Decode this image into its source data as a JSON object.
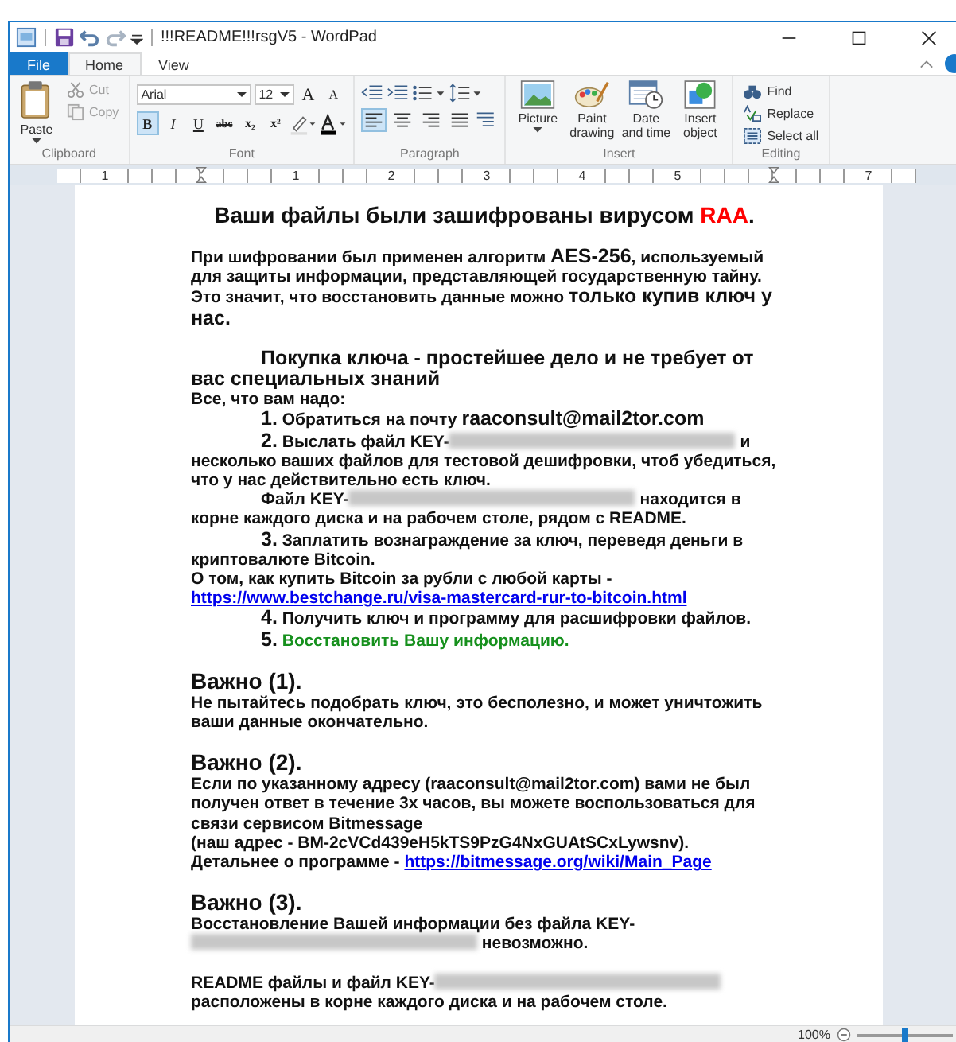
{
  "window": {
    "title": "!!!README!!!rsgV5 - WordPad"
  },
  "tabs": [
    {
      "label": "File",
      "kind": "file",
      "selected": false
    },
    {
      "label": "Home",
      "kind": "tab",
      "selected": true
    },
    {
      "label": "View",
      "kind": "tab",
      "selected": false
    }
  ],
  "ribbon": {
    "clipboard": {
      "label": "Clipboard",
      "paste": "Paste",
      "small": [
        {
          "label": "Cut",
          "kind": "cut",
          "disabled": true
        },
        {
          "label": "Copy",
          "kind": "copy",
          "disabled": true
        }
      ]
    },
    "font": {
      "label": "Font",
      "font_name": "Arial",
      "font_size": "12",
      "size_buttons": [
        {
          "label": "A",
          "kind": "grow"
        },
        {
          "label": "A",
          "kind": "shrink"
        }
      ],
      "format_buttons": [
        {
          "label": "B",
          "kind": "bold",
          "selected": true
        },
        {
          "label": "I",
          "kind": "italic",
          "selected": false
        },
        {
          "label": "U",
          "kind": "underline",
          "selected": false
        },
        {
          "label": "abc",
          "kind": "strike",
          "selected": false
        },
        {
          "label": "x₂",
          "kind": "sub",
          "selected": false
        },
        {
          "label": "x²",
          "kind": "sup",
          "selected": false
        }
      ]
    },
    "paragraph": {
      "label": "Paragraph",
      "align_buttons": [
        {
          "kind": "left",
          "selected": true
        },
        {
          "kind": "center",
          "selected": false
        },
        {
          "kind": "right",
          "selected": false
        },
        {
          "kind": "justify",
          "selected": false
        }
      ]
    },
    "insert": {
      "label": "Insert",
      "buttons": [
        {
          "label": "Picture",
          "kind": "picture"
        },
        {
          "label": "Paint drawing",
          "kind": "paint"
        },
        {
          "label": "Date and time",
          "kind": "datetime"
        },
        {
          "label": "Insert object",
          "kind": "object"
        }
      ]
    },
    "editing": {
      "label": "Editing",
      "buttons": [
        {
          "label": "Find",
          "kind": "find"
        },
        {
          "label": "Replace",
          "kind": "replace"
        },
        {
          "label": "Select all",
          "kind": "selectall"
        }
      ]
    }
  },
  "ruler": {
    "marks": [
      {
        "kind": "number",
        "label": "1"
      },
      {
        "kind": "marker"
      },
      {
        "kind": "number",
        "label": "1"
      },
      {
        "kind": "number",
        "label": "2"
      },
      {
        "kind": "number",
        "label": "3"
      },
      {
        "kind": "number",
        "label": "4"
      },
      {
        "kind": "number",
        "label": "5"
      },
      {
        "kind": "marker"
      },
      {
        "kind": "number",
        "label": "7"
      }
    ]
  },
  "document": [
    {
      "kind": "title",
      "segments": [
        {
          "text": "Ваши файлы были зашифрованы вирусом "
        },
        {
          "text": "RAA",
          "kind": "red"
        },
        {
          "text": "."
        }
      ]
    },
    {
      "kind": "blank"
    },
    {
      "kind": "para",
      "segments": [
        {
          "text": "При шифровании был применен алгоритм "
        },
        {
          "text": "AES-256",
          "kind": "large"
        },
        {
          "text": ", используемый для защиты информации, представляющей государственную тайну."
        }
      ]
    },
    {
      "kind": "para",
      "segments": [
        {
          "text": "Это значит, что восстановить данные можно "
        },
        {
          "text": "только купив ключ у нас.",
          "kind": "large"
        }
      ]
    },
    {
      "kind": "blank"
    },
    {
      "kind": "indented",
      "segments": [
        {
          "text": "Покупка ключа - простейшее дело и не требует от вас специальных знаний",
          "kind": "large"
        }
      ]
    },
    {
      "kind": "para",
      "segments": [
        {
          "text": "Все, что вам надо:"
        }
      ]
    },
    {
      "kind": "indented",
      "segments": [
        {
          "text": "1.",
          "kind": "large"
        },
        {
          "text": " Обратиться на почту "
        },
        {
          "text": "raaconsult@mail2tor.com",
          "kind": "large"
        }
      ]
    },
    {
      "kind": "indented",
      "segments": [
        {
          "text": "2.",
          "kind": "large"
        },
        {
          "text": " Выслать файл KEY-"
        },
        {
          "kind": "redaction"
        },
        {
          "text": " и несколько ваших файлов для тестовой дешифровки, чтоб убедиться, что у нас действительно есть ключ."
        }
      ]
    },
    {
      "kind": "indented",
      "segments": [
        {
          "text": "Файл KEY-"
        },
        {
          "kind": "redaction"
        },
        {
          "text": " находится в корне каждого диска и на рабочем столе, рядом с README."
        }
      ]
    },
    {
      "kind": "indented",
      "segments": [
        {
          "text": "3.",
          "kind": "large"
        },
        {
          "text": " Заплатить вознаграждение за ключ, переведя деньги в криптовалюте Bitcoin."
        }
      ]
    },
    {
      "kind": "para",
      "segments": [
        {
          "text": "О том, как купить Bitcoin за рубли с любой карты - "
        },
        {
          "text": "https://www.bestchange.ru/visa-mastercard-rur-to-bitcoin.html",
          "kind": "link"
        }
      ]
    },
    {
      "kind": "indented",
      "segments": [
        {
          "text": "4.",
          "kind": "large"
        },
        {
          "text": " Получить ключ и программу для расшифровки файлов."
        }
      ]
    },
    {
      "kind": "indented",
      "segments": [
        {
          "text": "5.",
          "kind": "large"
        },
        {
          "text": " Восстановить Вашу информацию.",
          "kind": "green"
        }
      ]
    },
    {
      "kind": "blank"
    },
    {
      "kind": "heading",
      "segments": [
        {
          "text": "Важно (1)."
        }
      ]
    },
    {
      "kind": "para",
      "segments": [
        {
          "text": "Не пытайтесь подобрать ключ, это бесполезно, и может уничтожить ваши данные окончательно."
        }
      ]
    },
    {
      "kind": "blank"
    },
    {
      "kind": "heading",
      "segments": [
        {
          "text": "Важно (2)."
        }
      ]
    },
    {
      "kind": "para",
      "segments": [
        {
          "text": "Если по указанному адресу (raaconsult@mail2tor.com) вами не был получен ответ в течение 3х часов, вы можете воспользоваться для связи сервисом Bitmessage"
        }
      ]
    },
    {
      "kind": "para",
      "segments": [
        {
          "text": "(наш адрес - BM-2cVCd439eH5kTS9PzG4NxGUAtSCxLywsnv)."
        }
      ]
    },
    {
      "kind": "para",
      "segments": [
        {
          "text": "Детальнее о программе - "
        },
        {
          "text": "https://bitmessage.org/wiki/Main_Page",
          "kind": "link"
        }
      ]
    },
    {
      "kind": "blank"
    },
    {
      "kind": "heading",
      "segments": [
        {
          "text": "Важно (3)."
        }
      ]
    },
    {
      "kind": "para",
      "segments": [
        {
          "text": "Восстановление Вашей информации без файла KEY-"
        },
        {
          "kind": "redaction"
        },
        {
          "text": " невозможно."
        }
      ]
    },
    {
      "kind": "blank"
    },
    {
      "kind": "para",
      "segments": [
        {
          "text": "README файлы и файл KEY-"
        },
        {
          "kind": "redaction"
        },
        {
          "text": " расположены в корне каждого диска и на рабочем столе."
        }
      ]
    }
  ],
  "status_bar": {
    "zoom": "100%",
    "level": 0.5
  }
}
